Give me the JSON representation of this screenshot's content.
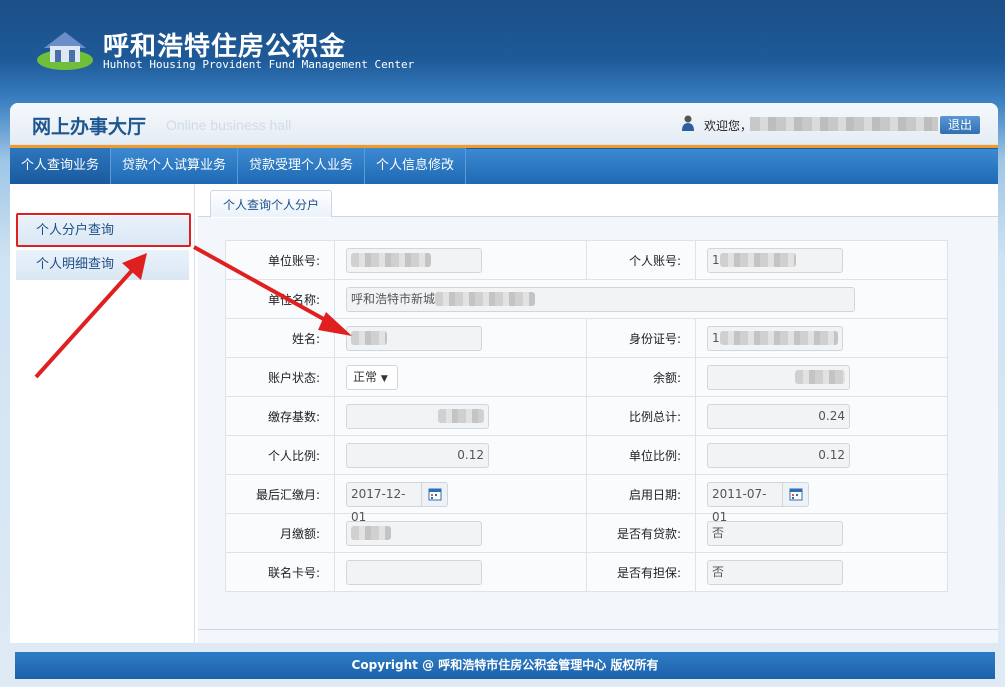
{
  "header": {
    "logo_cn": "呼和浩特住房公积金",
    "logo_en": "Huhhot Housing Provident Fund Management Center"
  },
  "titlebar": {
    "title_cn": "网上办事大厅",
    "title_en": "Online business hall",
    "welcome": "欢迎您，",
    "logout": "退出"
  },
  "nav": {
    "items": [
      {
        "label": "个人查询业务"
      },
      {
        "label": "贷款个人试算业务"
      },
      {
        "label": "贷款受理个人业务"
      },
      {
        "label": "个人信息修改"
      }
    ]
  },
  "sidebar": {
    "items": [
      {
        "label": "个人分户查询"
      },
      {
        "label": "个人明细查询"
      }
    ]
  },
  "tab": {
    "label": "个人查询个人分户"
  },
  "form": {
    "unit_account_label": "单位账号:",
    "personal_account_label": "个人账号:",
    "personal_account_prefix": "1",
    "unit_name_label": "单位名称:",
    "unit_name_value": "呼和浩特市新城",
    "name_label": "姓名:",
    "id_label": "身份证号:",
    "id_prefix": "1",
    "status_label": "账户状态:",
    "status_value": "正常",
    "balance_label": "余额:",
    "base_label": "缴存基数:",
    "ratio_total_label": "比例总计:",
    "ratio_total_value": "0.24",
    "personal_ratio_label": "个人比例:",
    "personal_ratio_value": "0.12",
    "unit_ratio_label": "单位比例:",
    "unit_ratio_value": "0.12",
    "last_pay_label": "最后汇缴月:",
    "last_pay_value": "2017-12-01",
    "start_date_label": "启用日期:",
    "start_date_value": "2011-07-01",
    "monthly_label": "月缴额:",
    "has_loan_label": "是否有贷款:",
    "has_loan_value": "否",
    "card_label": "联名卡号:",
    "has_guarantee_label": "是否有担保:",
    "has_guarantee_value": "否"
  },
  "footer": {
    "text": "Copyright @ 呼和浩特市住房公积金管理中心 版权所有"
  },
  "colors": {
    "nav": "#1f69b4",
    "accent": "#f19b2c",
    "annotation": "#e02020"
  }
}
